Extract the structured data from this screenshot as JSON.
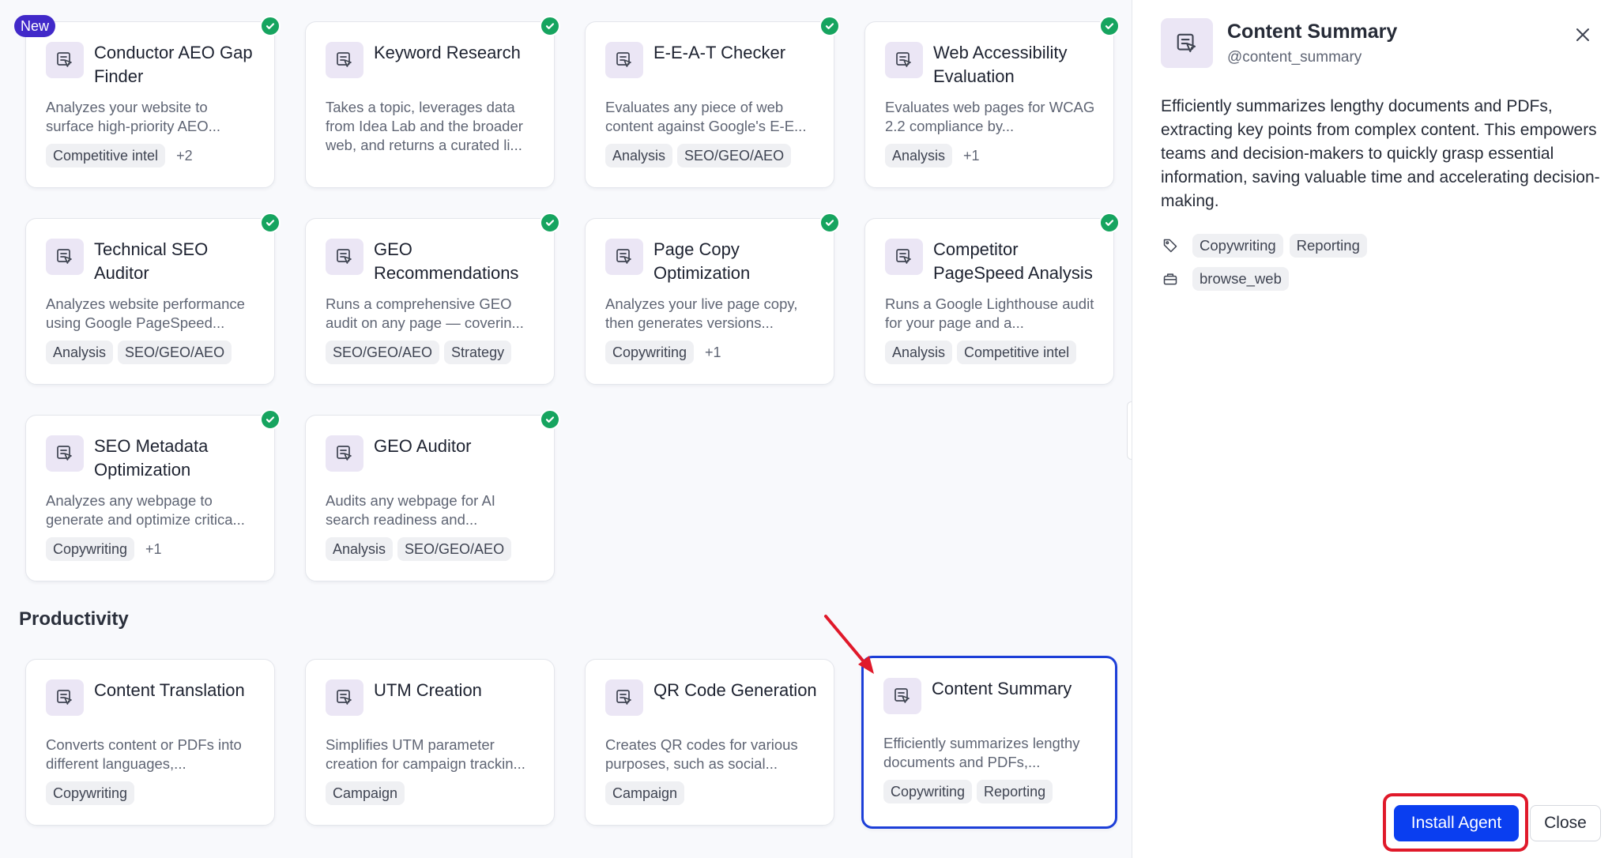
{
  "new_badge": "New",
  "section_productivity": "Productivity",
  "cards": [
    {
      "title": "Conductor AEO Gap Finder",
      "desc": "Analyzes your website to surface high-priority AEO...",
      "tags": [
        "Competitive intel"
      ],
      "more": "+2",
      "installed": true
    },
    {
      "title": "Keyword Research",
      "desc": "Takes a topic, leverages data from Idea Lab and the broader web, and returns a curated li...",
      "tags": [],
      "more": "",
      "installed": true
    },
    {
      "title": "E-E-A-T Checker",
      "desc": "Evaluates any piece of web content against Google's E-E...",
      "tags": [
        "Analysis",
        "SEO/GEO/AEO"
      ],
      "more": "",
      "installed": true
    },
    {
      "title": "Web Accessibility Evaluation",
      "desc": "Evaluates web pages for WCAG 2.2 compliance by...",
      "tags": [
        "Analysis"
      ],
      "more": "+1",
      "installed": true
    },
    {
      "title": "Technical SEO Auditor",
      "desc": "Analyzes website performance using Google PageSpeed...",
      "tags": [
        "Analysis",
        "SEO/GEO/AEO"
      ],
      "more": "",
      "installed": true
    },
    {
      "title": "GEO Recommendations",
      "desc": "Runs a comprehensive GEO audit on any page — coverin...",
      "tags": [
        "SEO/GEO/AEO",
        "Strategy"
      ],
      "more": "",
      "installed": true
    },
    {
      "title": "Page Copy Optimization",
      "desc": "Analyzes your live page copy, then generates versions...",
      "tags": [
        "Copywriting"
      ],
      "more": "+1",
      "installed": true
    },
    {
      "title": "Competitor PageSpeed Analysis",
      "desc": "Runs a Google Lighthouse audit for your page and a...",
      "tags": [
        "Analysis",
        "Competitive intel"
      ],
      "more": "",
      "installed": true
    },
    {
      "title": "SEO Metadata Optimization",
      "desc": "Analyzes any webpage to generate and optimize critica...",
      "tags": [
        "Copywriting"
      ],
      "more": "+1",
      "installed": true
    },
    {
      "title": "GEO Auditor",
      "desc": "Audits any webpage for AI search readiness and...",
      "tags": [
        "Analysis",
        "SEO/GEO/AEO"
      ],
      "more": "",
      "installed": true
    },
    {
      "title": "Content Translation",
      "desc": "Converts content or PDFs into different languages,...",
      "tags": [
        "Copywriting"
      ],
      "more": "",
      "installed": false
    },
    {
      "title": "UTM Creation",
      "desc": "Simplifies UTM parameter creation for campaign trackin...",
      "tags": [
        "Campaign"
      ],
      "more": "",
      "installed": false
    },
    {
      "title": "QR Code Generation",
      "desc": "Creates QR codes for various purposes, such as social...",
      "tags": [
        "Campaign"
      ],
      "more": "",
      "installed": false
    },
    {
      "title": "Content Summary",
      "desc": "Efficiently summarizes lengthy documents and PDFs,...",
      "tags": [
        "Copywriting",
        "Reporting"
      ],
      "more": "",
      "installed": false,
      "selected": true
    }
  ],
  "panel": {
    "title": "Content Summary",
    "handle": "@content_summary",
    "description": "Efficiently summarizes lengthy documents and PDFs, extracting key points from complex content. This empowers teams and decision-makers to quickly grasp essential information, saving valuable time and accelerating decision-making.",
    "tags": [
      "Copywriting",
      "Reporting"
    ],
    "tools": [
      "browse_web"
    ],
    "install_label": "Install Agent",
    "close_label": "Close"
  },
  "colors": {
    "accent": "#0a3ef0",
    "selected_border": "#1d3fd8",
    "check_green": "#16a45f",
    "new_badge": "#4129c9",
    "annotation_red": "#e0192a"
  }
}
